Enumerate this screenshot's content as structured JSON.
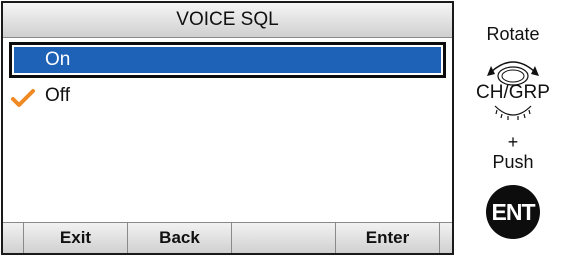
{
  "screen": {
    "title": "VOICE SQL",
    "items": [
      {
        "label": "On",
        "selected": true,
        "checked": false
      },
      {
        "label": "Off",
        "selected": false,
        "checked": true
      }
    ],
    "softkeys": [
      "",
      "Exit",
      "Back",
      "",
      "Enter",
      ""
    ]
  },
  "instructions": {
    "rotate": "Rotate",
    "knob_label": "CH/GRP",
    "plus": "+",
    "push": "Push",
    "ent_key": "ENT"
  },
  "colors": {
    "highlight": "#1d62b6",
    "check": "#f08a24"
  },
  "icons": {
    "check": "check-icon",
    "knob": "rotary-knob-icon"
  }
}
